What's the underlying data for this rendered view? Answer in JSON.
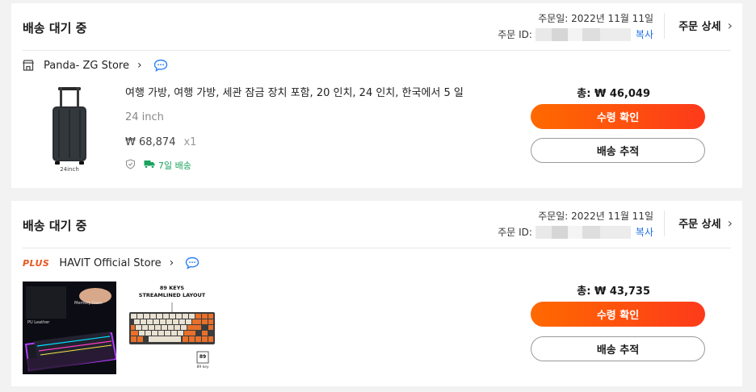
{
  "orders": [
    {
      "status": "배송 대기 중",
      "order_date_label": "주문일: 2022년 11월 11일",
      "order_id_label": "주문 ID:",
      "copy_label": "복사",
      "detail_label": "주문 상세",
      "store_name": "Panda- ZG Store",
      "product_title": "여행 가방, 여행 가방, 세관 잠금 장치 포함, 20 인치, 24 인치, 한국에서 5 일",
      "variant": "24 inch",
      "image_caption": "24inch",
      "price": "₩ 68,874",
      "quantity": "x1",
      "shipping_badge": "7일 배송",
      "total": "총: ₩ 46,049",
      "confirm_button": "수령 확인",
      "track_button": "배송 추적"
    },
    {
      "status": "배송 대기 중",
      "order_date_label": "주문일: 2022년 11월 11일",
      "order_id_label": "주문 ID:",
      "copy_label": "복사",
      "detail_label": "주문 상세",
      "store_badge": "PLUS",
      "store_name": "HAVIT Official Store",
      "image1_labels": {
        "left": "PU Leather",
        "right": "Memory foam"
      },
      "image2_labels": {
        "line1": "89 KEYS",
        "line2": "STREAMLINED LAYOUT",
        "key_count": "89",
        "key_label": "89 key"
      },
      "total": "총: ₩ 43,735",
      "confirm_button": "수령 확인",
      "track_button": "배송 추적"
    }
  ],
  "colors": {
    "accent_start": "#ff6a00",
    "accent_end": "#fd3a1b",
    "link": "#1f6fe0",
    "shipping_green": "#1aa260",
    "plus_badge": "#e8561f"
  },
  "icons": [
    "store-icon",
    "chevron-right-icon",
    "chat-icon",
    "shield-check-icon",
    "truck-icon"
  ]
}
